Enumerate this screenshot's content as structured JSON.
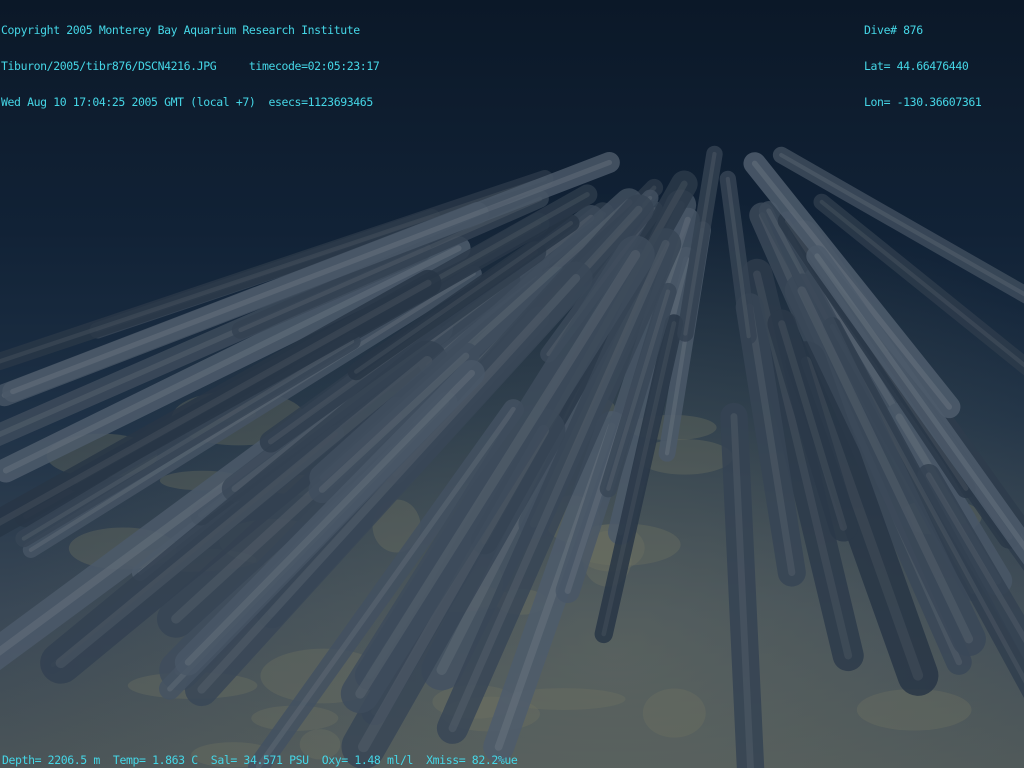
{
  "header": {
    "copyright": "Copyright 2005 Monterey Bay Aquarium Research Institute",
    "file_line": "Tiburon/2005/tibr876/DSCN4216.JPG     timecode=02:05:23:17",
    "date_line": "Wed Aug 10 17:04:25 2005 GMT (local +7)  esecs=1123693465"
  },
  "dive_info": {
    "dive": "Dive# 876",
    "lat": "Lat= 44.66476440",
    "lon": "Lon= -130.36607361"
  },
  "sensors": {
    "depth": "Depth= 2206.5 m",
    "temp": "Temp= 1.863 C",
    "sal": "Sal= 34.571 PSU",
    "oxy": "Oxy= 1.48 ml/l",
    "xmiss": "Xmiss= 82.2%ue"
  },
  "colors": {
    "overlay_text": "#45d6e6",
    "water": "#0c1a2c",
    "sediment": "#6f7260",
    "lava": "#3a4a5c"
  }
}
